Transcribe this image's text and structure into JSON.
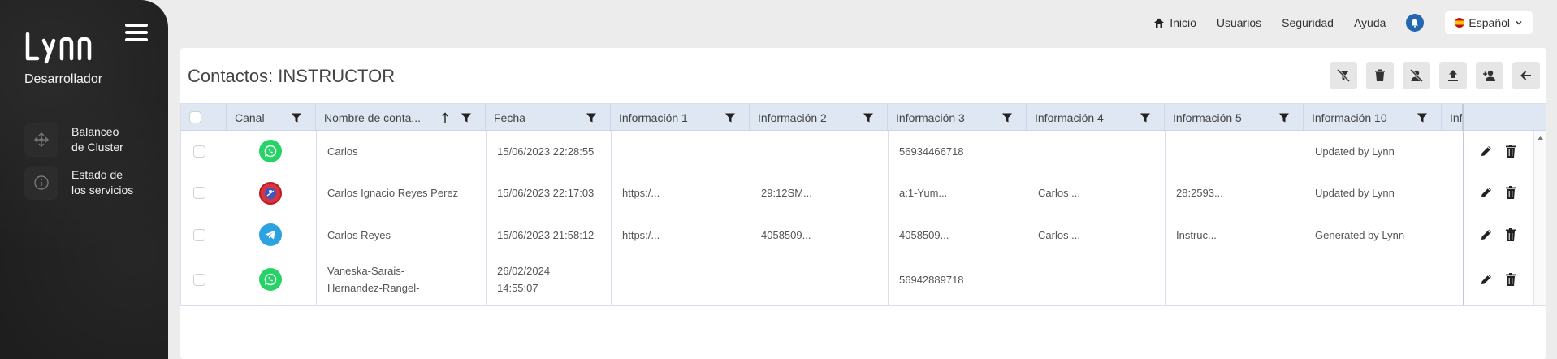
{
  "sidebar": {
    "logo_text": "LYNN",
    "role": "Desarrollador",
    "items": [
      {
        "label": "Balanceo\nde Cluster",
        "icon": "cluster-icon"
      },
      {
        "label": "Estado de\nlos servicios",
        "icon": "info-icon"
      }
    ]
  },
  "topnav": {
    "links": [
      "Inicio",
      "Usuarios",
      "Seguridad",
      "Ayuda"
    ],
    "language": "Español"
  },
  "page": {
    "title": "Contactos: INSTRUCTOR"
  },
  "toolbar": [
    "clear-filter-icon",
    "trash-icon",
    "user-off-icon",
    "upload-icon",
    "add-user-icon",
    "back-arrow-icon"
  ],
  "table": {
    "columns": [
      "Canal",
      "Nombre de conta...",
      "Fecha",
      "Información 1",
      "Información 2",
      "Información 3",
      "Información 4",
      "Información 5",
      "Información 10",
      "Inf"
    ],
    "rows": [
      {
        "canal": "whatsapp",
        "nombre": "Carlos",
        "fecha": "15/06/2023 22:28:55",
        "info1": "",
        "info2": "",
        "info3": "56934466718",
        "info4": "",
        "info5": "",
        "info10": "Updated by Lynn"
      },
      {
        "canal": "instructor",
        "nombre": "Carlos Ignacio Reyes Perez",
        "fecha": "15/06/2023 22:17:03",
        "info1": "https:/...",
        "info2": "29:12SM...",
        "info3": "a:1-Yum...",
        "info4": "Carlos ...",
        "info5": "28:2593...",
        "info10": "Updated by Lynn"
      },
      {
        "canal": "telegram",
        "nombre": "Carlos Reyes",
        "fecha": "15/06/2023 21:58:12",
        "info1": "https:/...",
        "info2": "4058509...",
        "info3": "4058509...",
        "info4": "Carlos ...",
        "info5": "Instruc...",
        "info10": "Generated by Lynn"
      },
      {
        "canal": "whatsapp",
        "nombre": "Vaneska-Sarais-\nHernandez-Rangel-",
        "fecha": "26/02/2024\n14:55:07",
        "info1": "",
        "info2": "",
        "info3": "56942889718",
        "info4": "",
        "info5": "",
        "info10": ""
      }
    ]
  },
  "colors": {
    "sidebar_bg": "#1e1e1e",
    "header_bg": "#dfe7f3",
    "whatsapp": "#25d366",
    "telegram": "#2aa3e0",
    "bell": "#2566b0"
  }
}
